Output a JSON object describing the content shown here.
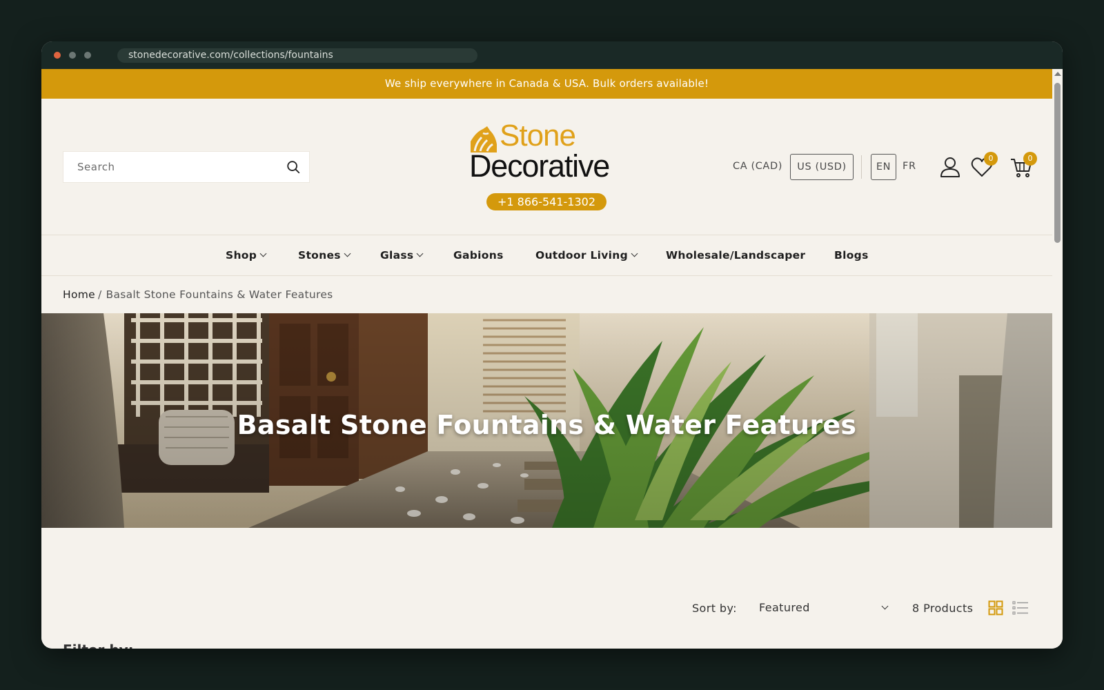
{
  "browser": {
    "url": "stonedecorative.com/collections/fountains"
  },
  "announcement": {
    "text": "We ship everywhere in Canada & USA. Bulk orders available!"
  },
  "header": {
    "search_placeholder": "Search",
    "logo": {
      "line1": "Stone",
      "line2": "Decorative"
    },
    "phone": "+1 866-541-1302",
    "currencies": [
      "CA (CAD)",
      "US (USD)"
    ],
    "selected_currency": "US (USD)",
    "languages": [
      "EN",
      "FR"
    ],
    "selected_language": "EN",
    "wishlist_count": "0",
    "cart_count": "0"
  },
  "nav": {
    "items": [
      {
        "label": "Shop",
        "has_dropdown": true
      },
      {
        "label": "Stones",
        "has_dropdown": true
      },
      {
        "label": "Glass",
        "has_dropdown": true
      },
      {
        "label": "Gabions",
        "has_dropdown": false
      },
      {
        "label": "Outdoor Living",
        "has_dropdown": true
      },
      {
        "label": "Wholesale/Landscaper",
        "has_dropdown": false
      },
      {
        "label": "Blogs",
        "has_dropdown": false
      }
    ]
  },
  "breadcrumb": {
    "home": "Home",
    "separator": "/",
    "current": "Basalt Stone Fountains & Water Features"
  },
  "hero": {
    "title": "Basalt Stone Fountains & Water Features"
  },
  "toolbar": {
    "sort_label": "Sort by:",
    "sort_value": "Featured",
    "product_count": "8 Products",
    "view_mode": "grid"
  },
  "sidebar": {
    "filter_label": "Filter by:"
  },
  "colors": {
    "accent": "#d4990c",
    "page_bg": "#f5f2ec",
    "frame_bg": "#14201d"
  }
}
